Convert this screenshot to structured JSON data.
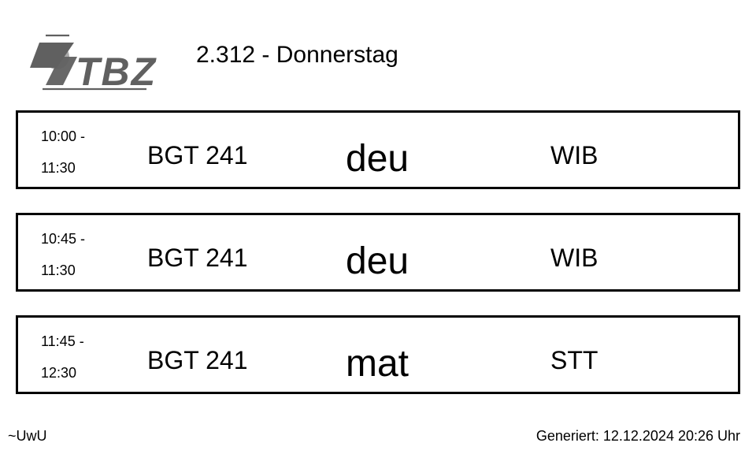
{
  "header": {
    "logo_text": "TBZ",
    "room_title": "2.312 - Donnerstag"
  },
  "lessons": [
    {
      "start": "10:00 -",
      "end": "11:30",
      "class": "BGT 241",
      "subject": "deu",
      "teacher": "WIB"
    },
    {
      "start": "10:45 -",
      "end": "11:30",
      "class": "BGT 241",
      "subject": "deu",
      "teacher": "WIB"
    },
    {
      "start": "11:45 -",
      "end": "12:30",
      "class": "BGT 241",
      "subject": "mat",
      "teacher": "STT"
    }
  ],
  "footer": {
    "left_text": "~UwU",
    "generated": "Generiert: 12.12.2024 20:26 Uhr"
  },
  "colors": {
    "logo_gray": "#606060",
    "logo_light": "#a8a8a8",
    "border": "#000000"
  },
  "icons": {
    "logo": "tbz-logo-icon"
  }
}
